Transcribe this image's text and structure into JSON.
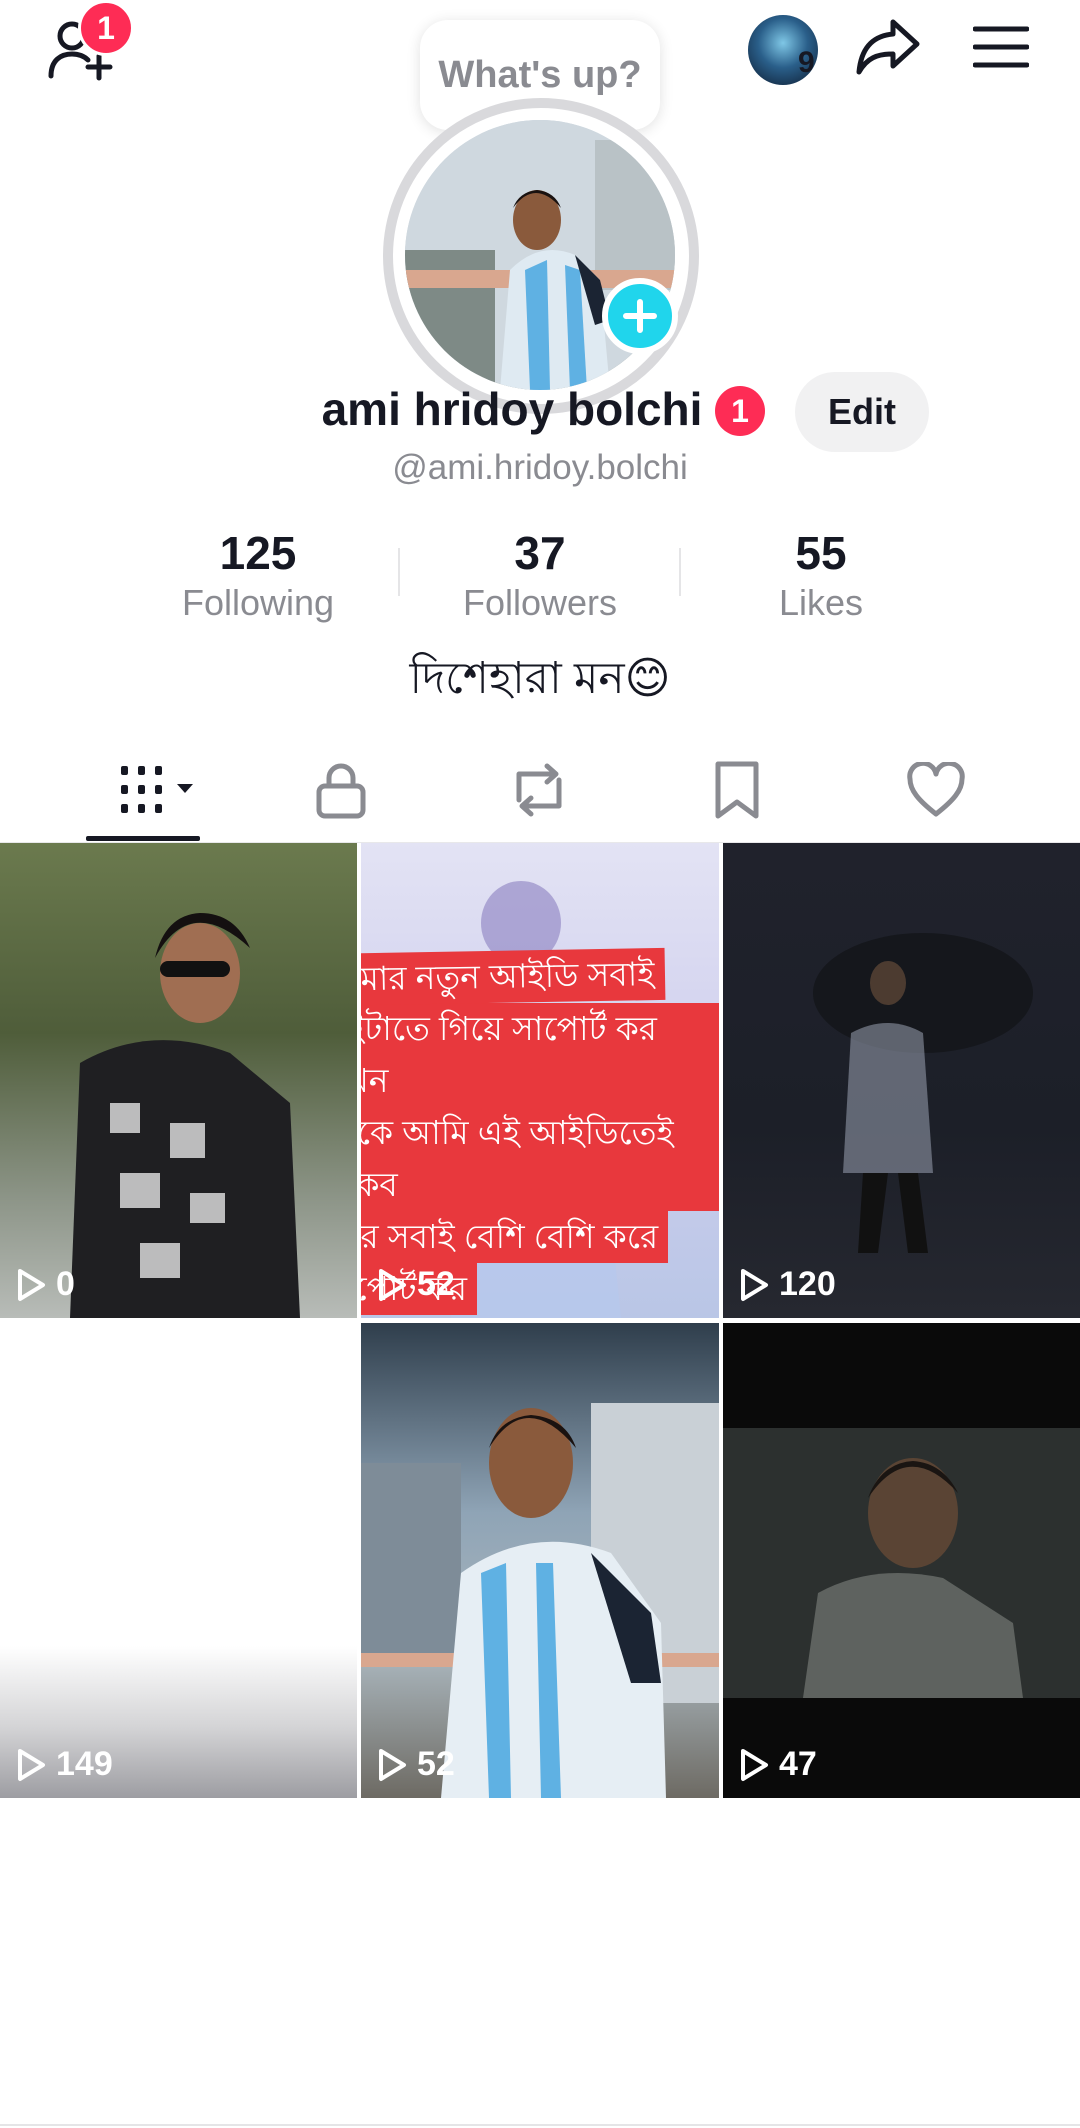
{
  "top_bar": {
    "add_friend_badge": "1",
    "story_count": "9"
  },
  "status_bubble": "What's up?",
  "profile": {
    "name": "ami hridoy bolchi",
    "name_badge": "1",
    "edit_label": "Edit",
    "handle": "@ami.hridoy.bolchi",
    "bio": "দিশেহারা মন😊"
  },
  "stats": [
    {
      "value": "125",
      "label": "Following"
    },
    {
      "value": "37",
      "label": "Followers"
    },
    {
      "value": "55",
      "label": "Likes"
    }
  ],
  "tabs": [
    "videos-grid-icon",
    "lock-icon",
    "repost-icon",
    "bookmark-icon",
    "heart-icon"
  ],
  "videos": [
    {
      "views": "0"
    },
    {
      "views": "52",
      "caption": [
        "আমার নতুন আইডি সবাই",
        "এইটাতে গিয়ে সাপোর্ট কর এখন",
        "থেকে আমি এই আইডিতেই তাকব",
        "আর সবাই বেশি বেশি করে",
        "সাপোর্ট কর"
      ]
    },
    {
      "views": "120"
    },
    {
      "views": "149"
    },
    {
      "views": "52"
    },
    {
      "views": "47"
    }
  ],
  "colors": {
    "accent_red": "#fe2c55",
    "add_blue": "#20d5ec",
    "caption_red": "#e8383d"
  }
}
